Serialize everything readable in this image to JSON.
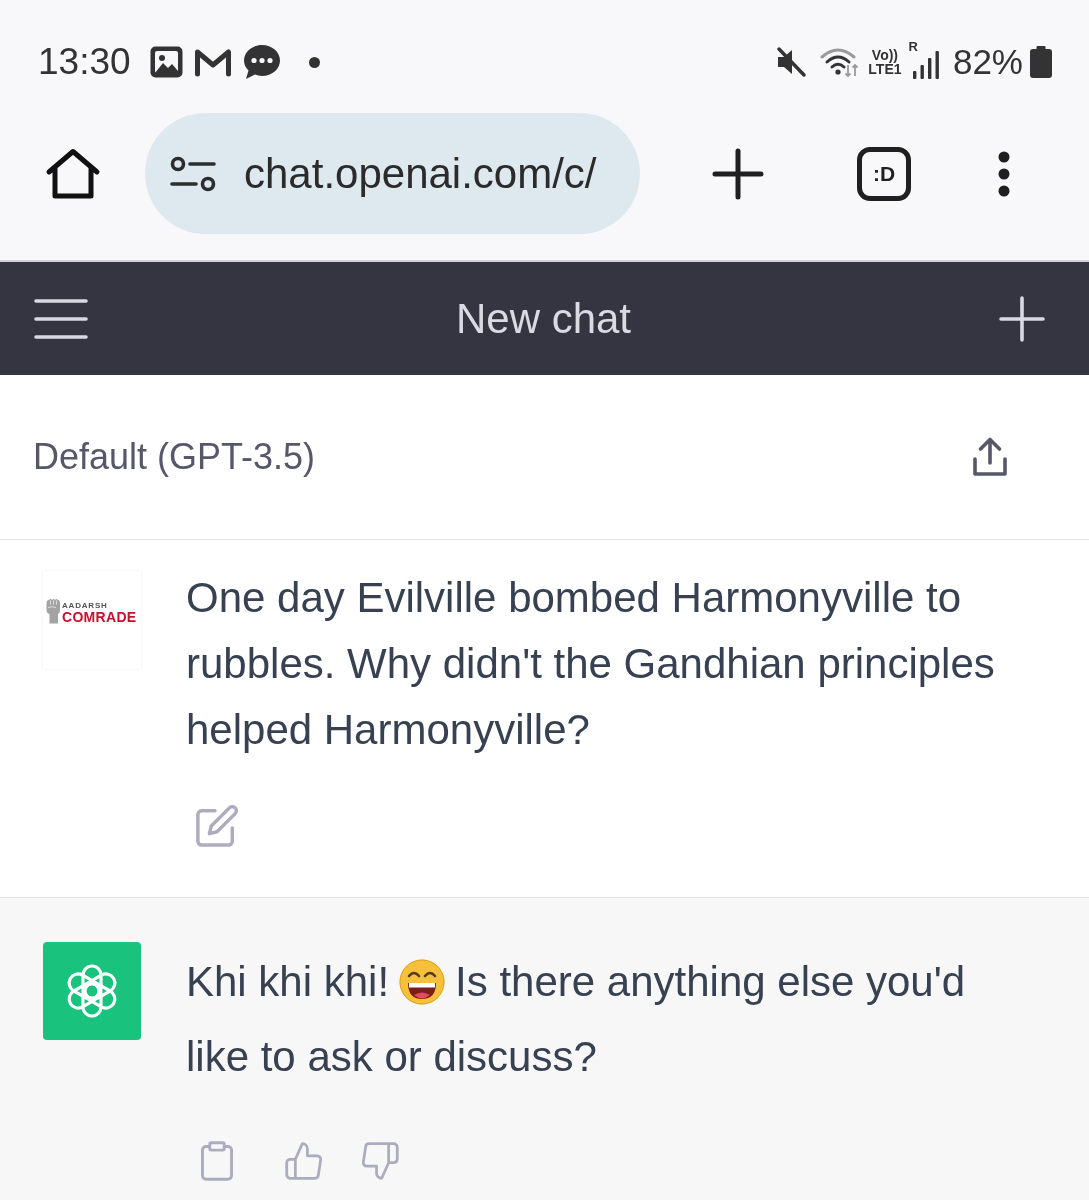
{
  "status_bar": {
    "time": "13:30",
    "volte_label": "Vo))",
    "network_label": "LTE1",
    "roaming_label": "R",
    "battery": "82%"
  },
  "browser_bar": {
    "url": "chat.openai.com/c/",
    "tab_count": ":D"
  },
  "header": {
    "title": "New chat"
  },
  "model_bar": {
    "model": "Default (GPT-3.5)"
  },
  "messages": [
    {
      "kind": "user",
      "avatar_logo": {
        "line_1": "AADARSH",
        "line_2": "COMRADE"
      },
      "parts": [
        {
          "kind": "text",
          "text": "One day Evilville bombed Harmonyville to rubbles. Why didn't the Gandhian principles helped Harmonyville?"
        }
      ]
    },
    {
      "kind": "assistant",
      "parts": [
        {
          "kind": "text",
          "text": "Khi khi khi!"
        },
        {
          "kind": "emoji"
        },
        {
          "kind": "text",
          "text": "Is there anything else you'd"
        },
        {
          "kind": "text",
          "text": "like to ask or discuss?"
        }
      ]
    }
  ]
}
